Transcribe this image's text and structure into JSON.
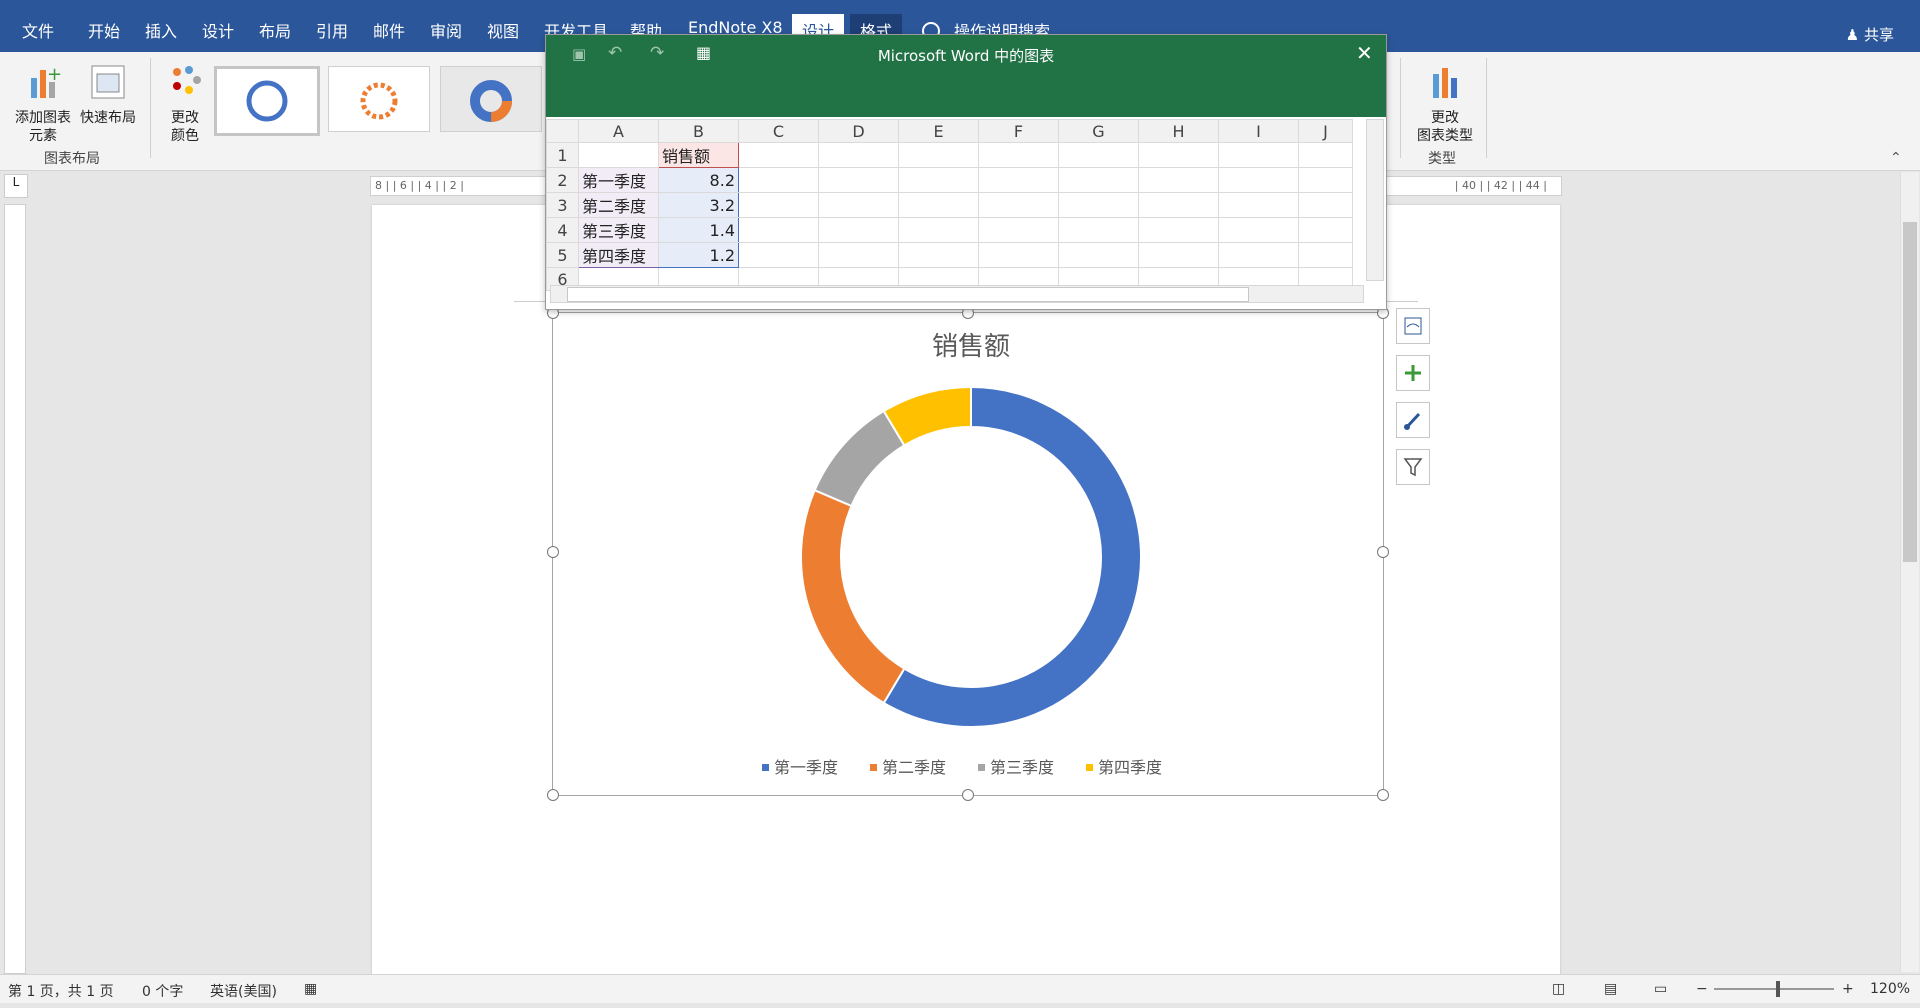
{
  "menu": {
    "tabs": [
      "文件",
      "开始",
      "插入",
      "设计",
      "布局",
      "引用",
      "邮件",
      "审阅",
      "视图",
      "开发工具",
      "帮助",
      "EndNote X8",
      "设计",
      "格式"
    ],
    "search_label": "操作说明搜索",
    "share_label": "共享",
    "colors": {
      "bar": "#2b579a",
      "context_tab": "#1d3f75"
    }
  },
  "ribbon": {
    "add_element_line1": "添加图表",
    "add_element_line2": "元素",
    "quick_layout": "快速布局",
    "group_layout_label": "图表布局",
    "change_colors_line1": "更改",
    "change_colors_line2": "颜色",
    "change_type_line1": "更改",
    "change_type_line2": "图表类型",
    "group_type_label": "类型"
  },
  "dialog": {
    "title": "Microsoft Word 中的图表",
    "header_color": "#217346",
    "columns": [
      "A",
      "B",
      "C",
      "D",
      "E",
      "F",
      "G",
      "H",
      "I",
      "J"
    ],
    "rows": [
      {
        "num": "1",
        "a": "",
        "b": "销售额"
      },
      {
        "num": "2",
        "a": "第一季度",
        "b": "8.2"
      },
      {
        "num": "3",
        "a": "第二季度",
        "b": "3.2"
      },
      {
        "num": "4",
        "a": "第三季度",
        "b": "1.4"
      },
      {
        "num": "5",
        "a": "第四季度",
        "b": "1.2"
      },
      {
        "num": "6",
        "a": "",
        "b": ""
      }
    ]
  },
  "ruler": {
    "h_left": "8 | | 6 | | 4 | | 2 |",
    "h_right": "| 40 | | 42 | | 44 |"
  },
  "chart_data": {
    "type": "pie",
    "variant": "doughnut",
    "title": "销售额",
    "categories": [
      "第一季度",
      "第二季度",
      "第三季度",
      "第四季度"
    ],
    "values": [
      8.2,
      3.2,
      1.4,
      1.2
    ],
    "colors": [
      "#4472c4",
      "#ed7d31",
      "#a5a5a5",
      "#ffc000"
    ],
    "legend_position": "bottom"
  },
  "status": {
    "page": "第 1 页，共 1 页",
    "words": "0 个字",
    "language": "英语(美国)",
    "zoom": "120%"
  }
}
